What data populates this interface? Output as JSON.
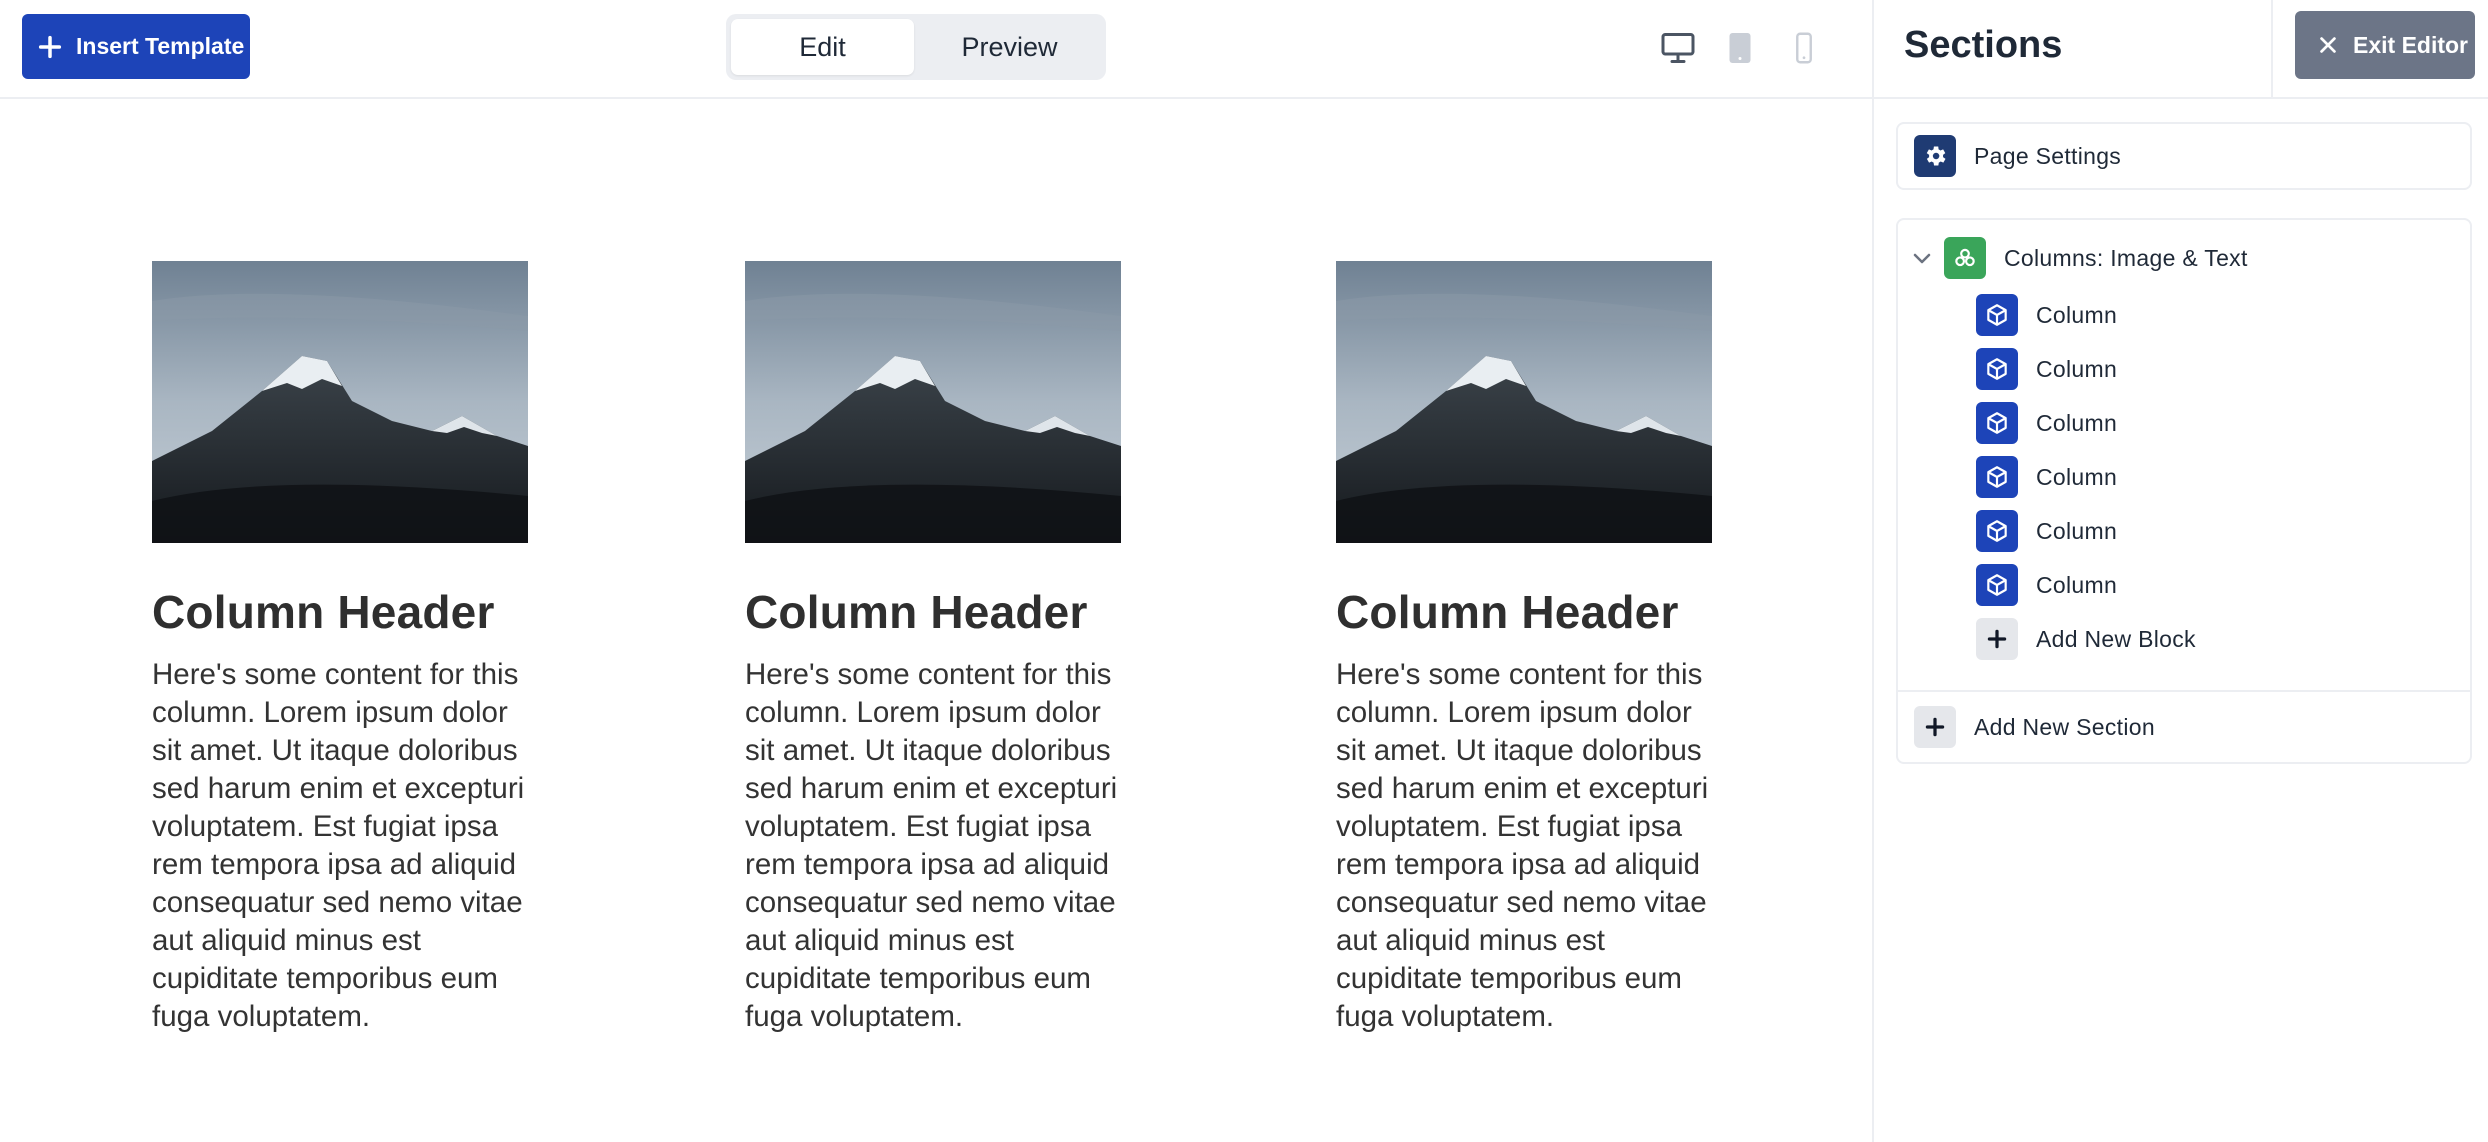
{
  "toolbar": {
    "insert_template_label": "Insert Template",
    "view_tabs": [
      {
        "label": "Edit",
        "active": true
      },
      {
        "label": "Preview",
        "active": false
      }
    ],
    "devices": [
      {
        "icon": "desktop-icon",
        "active": true
      },
      {
        "icon": "tablet-icon",
        "active": false
      },
      {
        "icon": "mobile-icon",
        "active": false
      }
    ]
  },
  "content": {
    "columns": [
      {
        "header": "Column Header",
        "body": "Here's some content for this column. Lorem ipsum dolor sit amet. Ut itaque doloribus sed harum enim et excepturi voluptatem. Est fugiat ipsa rem tempora ipsa ad aliquid consequatur sed nemo vitae aut aliquid minus est cupiditate temporibus eum fuga voluptatem.",
        "image": "mountain-image"
      },
      {
        "header": "Column Header",
        "body": "Here's some content for this column. Lorem ipsum dolor sit amet. Ut itaque doloribus sed harum enim et excepturi voluptatem. Est fugiat ipsa rem tempora ipsa ad aliquid consequatur sed nemo vitae aut aliquid minus est cupiditate temporibus eum fuga voluptatem.",
        "image": "mountain-image"
      },
      {
        "header": "Column Header",
        "body": "Here's some content for this column. Lorem ipsum dolor sit amet. Ut itaque doloribus sed harum enim et excepturi voluptatem. Est fugiat ipsa rem tempora ipsa ad aliquid consequatur sed nemo vitae aut aliquid minus est cupiditate temporibus eum fuga voluptatem.",
        "image": "mountain-image"
      }
    ]
  },
  "sidebar": {
    "title": "Sections",
    "exit_label": "Exit Editor",
    "page_settings_label": "Page Settings",
    "section": {
      "label": "Columns: Image & Text",
      "expanded": true,
      "blocks": [
        {
          "label": "Column"
        },
        {
          "label": "Column"
        },
        {
          "label": "Column"
        },
        {
          "label": "Column"
        },
        {
          "label": "Column"
        },
        {
          "label": "Column"
        }
      ],
      "add_block_label": "Add New Block"
    },
    "add_section_label": "Add New Section"
  },
  "colors": {
    "primary": "#1d44b8",
    "settings_icon_bg": "#1f3b73",
    "section_icon_bg": "#3aa55a",
    "exit_button_bg": "#6c7587",
    "border": "#eceef2"
  }
}
